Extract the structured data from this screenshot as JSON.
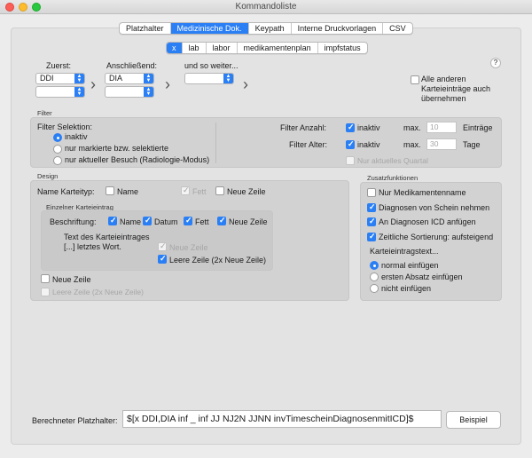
{
  "window": {
    "title": "Kommandoliste"
  },
  "main_tabs": [
    {
      "label": "Platzhalter",
      "selected": false
    },
    {
      "label": "Medizinische Dok.",
      "selected": true
    },
    {
      "label": "Keypath",
      "selected": false
    },
    {
      "label": "Interne Druckvorlagen",
      "selected": false
    },
    {
      "label": "CSV",
      "selected": false
    }
  ],
  "sub_tabs": [
    {
      "label": "x",
      "selected": true
    },
    {
      "label": "lab",
      "selected": false
    },
    {
      "label": "labor",
      "selected": false
    },
    {
      "label": "medikamentenplan",
      "selected": false
    },
    {
      "label": "impfstatus",
      "selected": false
    }
  ],
  "sequence": {
    "first_label": "Zuerst:",
    "first_value": "DDI",
    "first_value2": "",
    "then_label": "Anschließend:",
    "then_value": "DIA",
    "then_value2": "",
    "more_label": "und so weiter...",
    "more_value": "",
    "all_other": "Alle anderen Karteieinträge auch übernehmen",
    "help": "?"
  },
  "filter": {
    "section": "Filter",
    "selection_label": "Filter Selektion:",
    "options": [
      "inaktiv",
      "nur markierte bzw. selektierte",
      "nur aktueller Besuch (Radiologie-Modus)"
    ],
    "count_label": "Filter Anzahl:",
    "count_inactive": "inaktiv",
    "count_max": "max.",
    "count_value": "10",
    "count_unit": "Einträge",
    "age_label": "Filter Alter:",
    "age_inactive": "inaktiv",
    "age_max": "max.",
    "age_value": "30",
    "age_unit": "Tage",
    "current_quarter": "Nur aktuelles Quartal"
  },
  "design": {
    "section": "Design",
    "name_type_label": "Name Karteityp:",
    "name": "Name",
    "bold": "Fett",
    "new_line": "Neue Zeile",
    "single_entry_section": "Einzelner Karteieintrag",
    "caption_label": "Beschriftung:",
    "caption_name": "Name",
    "caption_date": "Datum",
    "caption_bold": "Fett",
    "caption_newline": "Neue Zeile",
    "text_label_1": "Text des Karteieintrages",
    "text_label_2": "[...] letztes Wort.",
    "text_newline": "Neue Zeile",
    "text_empty_line": "Leere Zeile (2x Neue Zeile)",
    "outer_newline": "Neue Zeile",
    "outer_empty_line": "Leere Zeile (2x Neue Zeile)"
  },
  "extra": {
    "section": "Zusatzfunktionen",
    "only_med": "Nur Medikamentenname",
    "diag_schein": "Diagnosen von Schein nehmen",
    "icd": "An Diagnosen ICD anfügen",
    "sort": "Zeitliche Sortierung: aufsteigend",
    "text_label": "Karteieintragstext...",
    "insert_options": [
      "normal einfügen",
      "ersten Absatz einfügen",
      "nicht einfügen"
    ]
  },
  "computed": {
    "label": "Berechneter Platzhalter:",
    "value": "$[x DDI,DIA inf _ inf JJ NJ2N JJNN invTimescheinDiagnosenmitICD]$",
    "example_button": "Beispiel"
  }
}
